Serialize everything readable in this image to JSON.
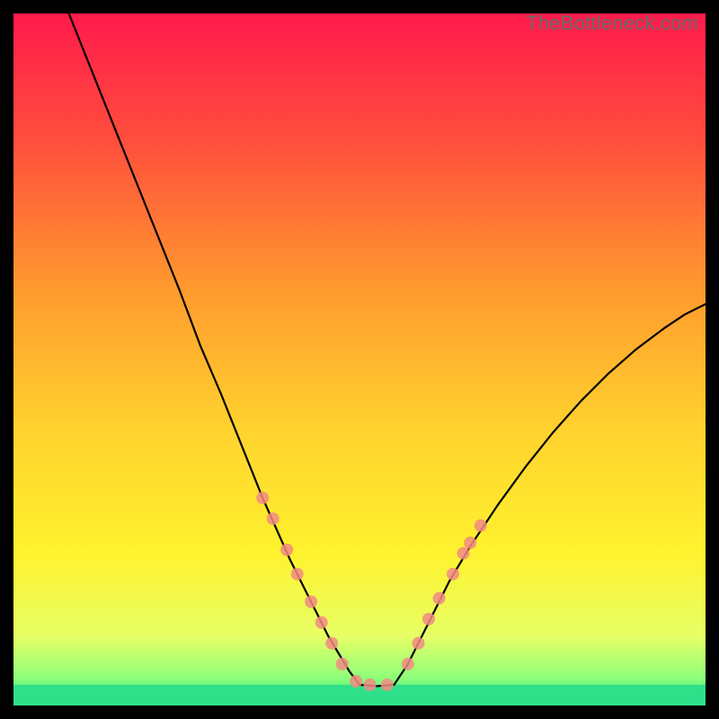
{
  "watermark": "TheBottleneck.com",
  "chart_data": {
    "type": "line",
    "title": "",
    "xlabel": "",
    "ylabel": "",
    "xlim": [
      0,
      100
    ],
    "ylim": [
      0,
      100
    ],
    "grid": false,
    "legend": false,
    "background_gradient_stops": [
      {
        "offset": 0.0,
        "color": "#ff1a4b"
      },
      {
        "offset": 0.18,
        "color": "#ff4d3d"
      },
      {
        "offset": 0.4,
        "color": "#ff9a2e"
      },
      {
        "offset": 0.6,
        "color": "#ffd22e"
      },
      {
        "offset": 0.78,
        "color": "#fff22e"
      },
      {
        "offset": 0.9,
        "color": "#e7ff66"
      },
      {
        "offset": 0.96,
        "color": "#8eff7a"
      },
      {
        "offset": 1.0,
        "color": "#19e27a"
      }
    ],
    "series": [
      {
        "name": "left-curve",
        "stroke": "#000000",
        "stroke_width": 2.2,
        "x": [
          8,
          12,
          16,
          20,
          24,
          27,
          30,
          32,
          34,
          36,
          38,
          40,
          42,
          44,
          45.5,
          47,
          48.5,
          50
        ],
        "y": [
          100,
          90,
          80,
          70,
          60,
          52,
          45,
          40,
          35,
          30,
          25.5,
          21,
          17,
          13,
          10,
          7.5,
          5,
          3
        ]
      },
      {
        "name": "right-curve",
        "stroke": "#000000",
        "stroke_width": 2.2,
        "x": [
          55,
          57,
          59,
          61,
          63,
          66,
          70,
          74,
          78,
          82,
          86,
          90,
          94,
          97,
          100
        ],
        "y": [
          3,
          6,
          10,
          14,
          18,
          23,
          29,
          34.5,
          39.5,
          44,
          48,
          51.5,
          54.5,
          56.5,
          58
        ]
      },
      {
        "name": "valley-floor",
        "stroke": "#000000",
        "stroke_width": 2.2,
        "x": [
          50,
          52.5,
          55
        ],
        "y": [
          3,
          2.8,
          3
        ]
      }
    ],
    "markers": {
      "name": "highlighted-dots",
      "fill": "#f28b82",
      "fill_opacity": 0.85,
      "radius": 7,
      "points": [
        {
          "x": 36,
          "y": 30
        },
        {
          "x": 37.5,
          "y": 27
        },
        {
          "x": 39.5,
          "y": 22.5
        },
        {
          "x": 41,
          "y": 19
        },
        {
          "x": 43,
          "y": 15
        },
        {
          "x": 44.5,
          "y": 12
        },
        {
          "x": 46,
          "y": 9
        },
        {
          "x": 47.5,
          "y": 6
        },
        {
          "x": 49.5,
          "y": 3.5
        },
        {
          "x": 51.5,
          "y": 3
        },
        {
          "x": 54,
          "y": 3
        },
        {
          "x": 57,
          "y": 6
        },
        {
          "x": 58.5,
          "y": 9
        },
        {
          "x": 60,
          "y": 12.5
        },
        {
          "x": 61.5,
          "y": 15.5
        },
        {
          "x": 63.5,
          "y": 19
        },
        {
          "x": 65,
          "y": 22
        },
        {
          "x": 66,
          "y": 23.5
        },
        {
          "x": 67.5,
          "y": 26
        }
      ]
    },
    "floor_fill": {
      "color": "#2fe08a",
      "y_from": 0,
      "y_to": 3
    }
  }
}
